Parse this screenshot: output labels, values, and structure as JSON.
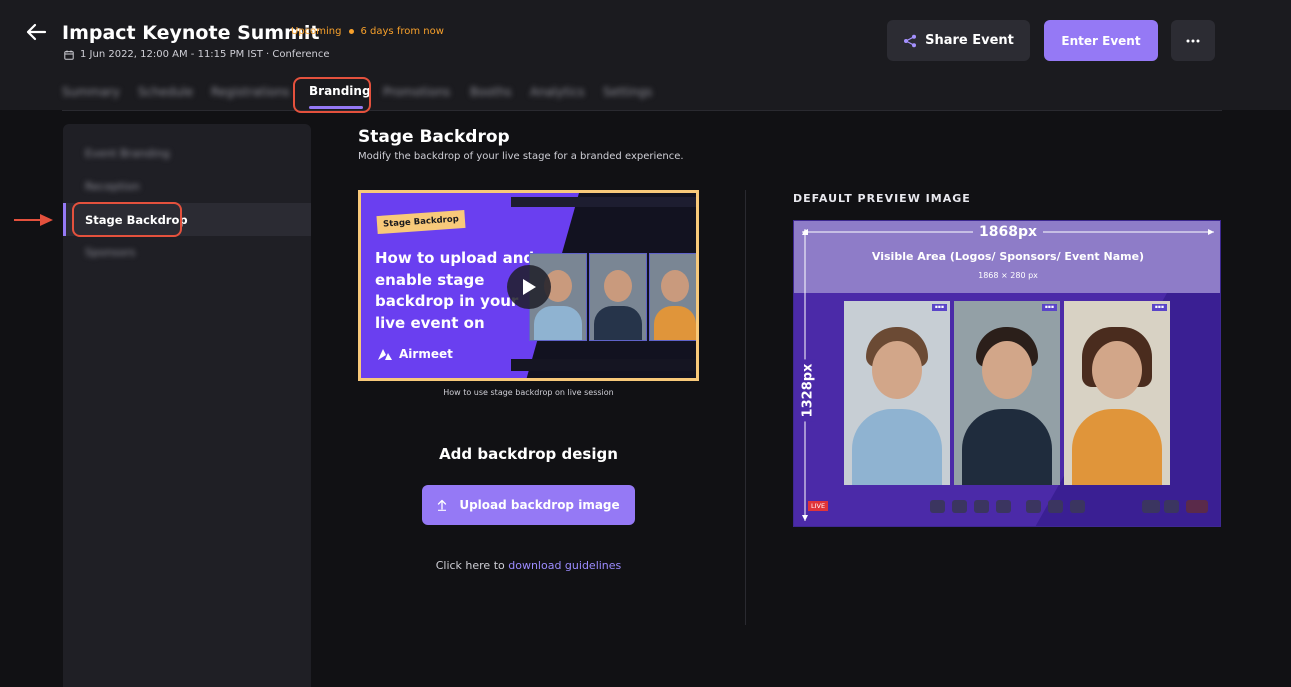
{
  "header": {
    "title": "Impact Keynote Summit",
    "status": "Upcoming",
    "countdown": "6 days from now",
    "meta": "1 Jun 2022, 12:00 AM - 11:15 PM IST · Conference",
    "share_label": "Share Event",
    "enter_label": "Enter Event",
    "more_label": "···"
  },
  "tabs": {
    "items": [
      "Summary",
      "Schedule",
      "Registrations",
      "Promotions",
      "Booths",
      "Analytics",
      "Settings"
    ],
    "active": "Branding"
  },
  "sidebar": {
    "items": [
      "Event Branding",
      "Reception",
      "Sponsors"
    ],
    "active": "Stage Backdrop"
  },
  "main": {
    "title": "Stage Backdrop",
    "subtitle": "Modify the backdrop of your live stage for a branded experience.",
    "video": {
      "tag": "Stage Backdrop",
      "headline": "How to upload and enable stage backdrop in your live event on",
      "brand": "Airmeet",
      "caption": "How to use stage backdrop on live session"
    },
    "add_title": "Add backdrop design",
    "upload_label": "Upload backdrop image",
    "guide_prefix": "Click here to",
    "guide_link": "download guidelines"
  },
  "preview": {
    "label": "DEFAULT PREVIEW IMAGE",
    "width_label": "1868px",
    "visible_area": "Visible Area (Logos/ Sponsors/ Event Name)",
    "visible_dim": "1868 × 280 px",
    "height_label": "1328px",
    "live": "LIVE"
  },
  "colors": {
    "accent": "#9579f5",
    "warning": "#f7a02b",
    "highlight": "#e4513d"
  }
}
